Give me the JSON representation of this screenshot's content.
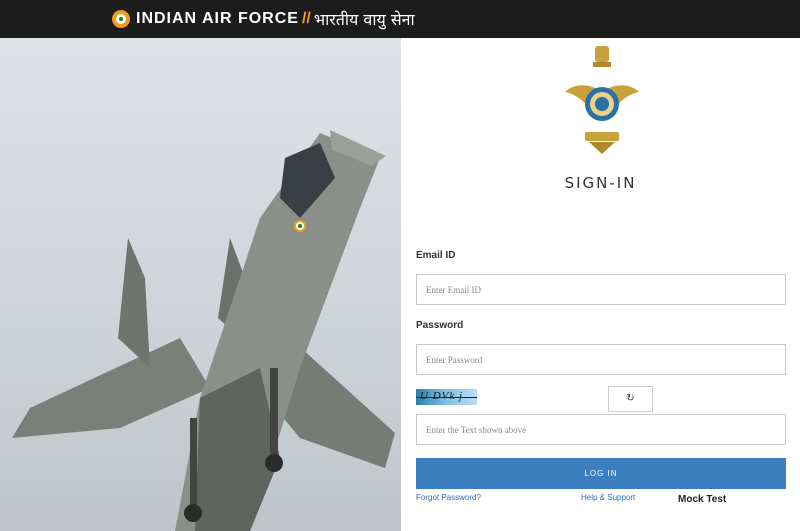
{
  "header": {
    "brand_en": "INDIAN AIR FORCE",
    "brand_sep": "//",
    "brand_hi": "भारतीय वायु सेना"
  },
  "hero": {
    "image_subject": "fighter-jet"
  },
  "form": {
    "title": "SIGN-IN",
    "email_label": "Email ID",
    "email_placeholder": "Enter Email ID",
    "password_label": "Password",
    "password_placeholder": "Enter Password",
    "captcha_text": "U DVk j",
    "refresh_icon": "refresh-icon",
    "captcha_placeholder": "Enter the Text shown above",
    "login_label": "LOG IN",
    "forgot_label": "Forgot Password?",
    "help_label": "Help & Support",
    "mock_label": "Mock Test"
  },
  "colors": {
    "topbar": "#1c1c1c",
    "accent": "#3c7fc1",
    "saffron": "#f29b1d"
  }
}
